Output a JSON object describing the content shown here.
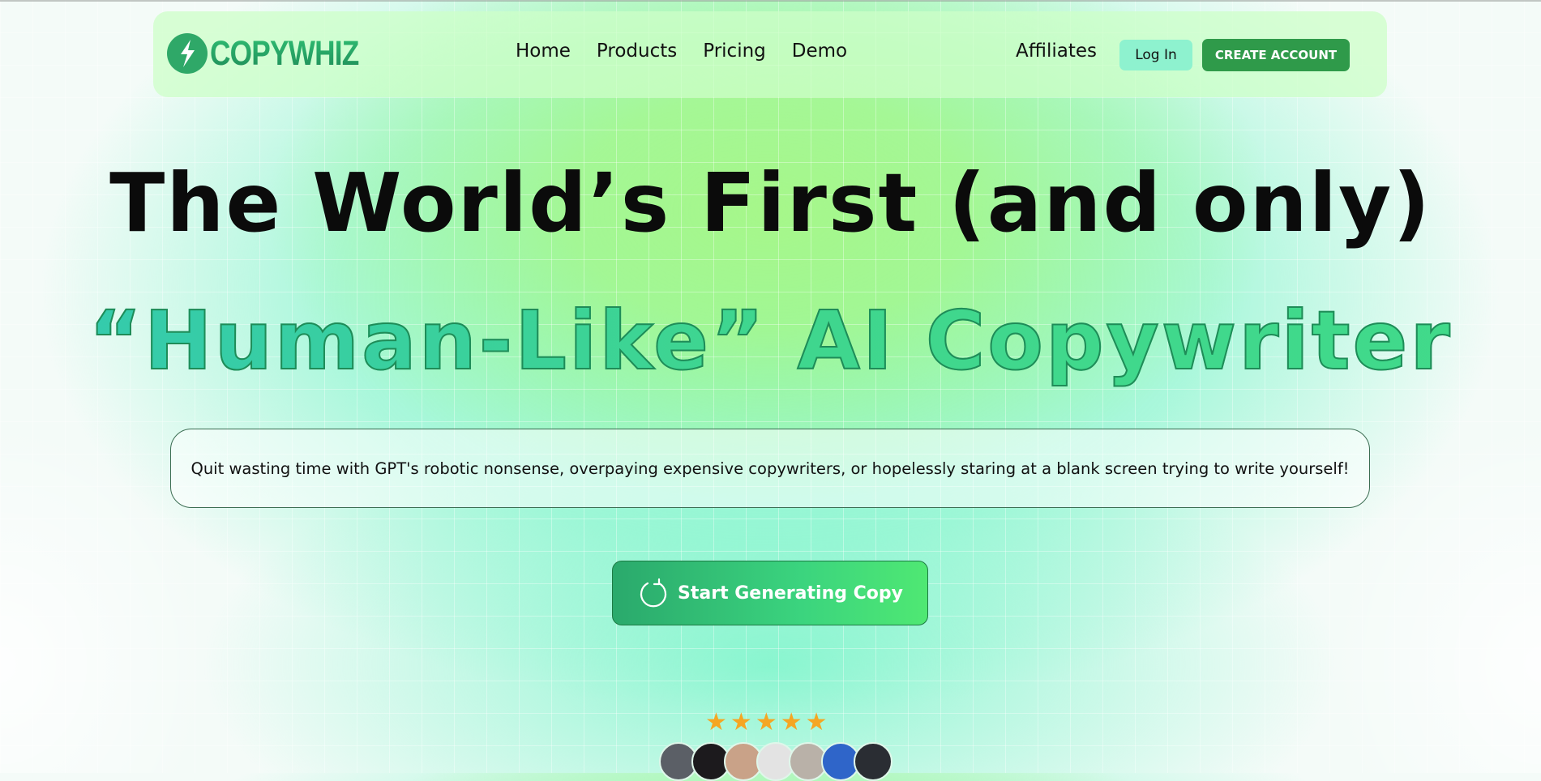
{
  "nav": {
    "logo_text": "COPYWHIZ",
    "links": [
      "Home",
      "Products",
      "Pricing",
      "Demo"
    ],
    "affiliates": "Affiliates",
    "login": "Log In",
    "create_account": "CREATE ACCOUNT"
  },
  "hero": {
    "headline_line1": "The World’s First (and only)",
    "headline_line2": "“Human-Like” AI Copywriter",
    "subtext": "Quit wasting time with GPT's robotic nonsense, overpaying expensive copywriters, or hopelessly staring at a blank screen trying to write yourself!",
    "cta_label": "Start Generating Copy"
  },
  "rating": {
    "stars": 5,
    "avatar_colors": [
      "#5b5f66",
      "#1c1a1d",
      "#c9a288",
      "#e3e3e3",
      "#b9b1a8",
      "#2f65c9",
      "#2a2d33"
    ]
  },
  "colors": {
    "accent_green": "#2f9a4a",
    "headline_gradient_start": "#33c9b0",
    "headline_gradient_end": "#41da8a",
    "star": "#f5a623"
  }
}
